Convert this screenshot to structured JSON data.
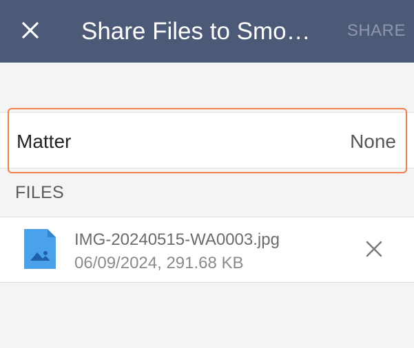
{
  "header": {
    "title": "Share Files to Smo…",
    "share_label": "SHARE",
    "close_icon": "close-icon",
    "background_color": "#4d5a77"
  },
  "matter": {
    "label": "Matter",
    "value": "None",
    "highlight_color": "#f07f4a"
  },
  "files_section": {
    "header": "FILES",
    "items": [
      {
        "name": "IMG-20240515-WA0003.jpg",
        "meta": "06/09/2024, 291.68 KB",
        "icon": "image-file-icon",
        "remove_icon": "close-icon"
      }
    ]
  }
}
